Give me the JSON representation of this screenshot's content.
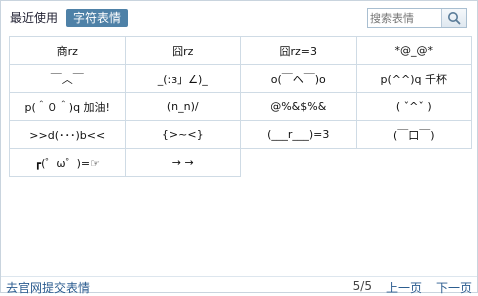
{
  "tabs": [
    {
      "label": "最近使用",
      "active": false
    },
    {
      "label": "字符表情",
      "active": true
    }
  ],
  "search": {
    "placeholder": "搜索表情",
    "icon": "search-icon"
  },
  "emoticons": [
    "商rz",
    "囧rz",
    "囧rz=3",
    "*@_@*",
    "￣︿￣",
    "_(:з」∠)_",
    "o(￣ヘ￣)o",
    "p(^^)q 千杯",
    "p(＾０＾)q 加油!",
    "(n_n)/",
    "@%&$%&",
    "( ˇ^ˇ )",
    ">>d(･･･)b<<",
    "{>~<}",
    "(___r___)=3",
    "(￣口￣)",
    "┏(゜ω゜)=☞",
    "→ →"
  ],
  "footer": {
    "submit_link": "去官网提交表情",
    "page_info": "5/5",
    "prev": "上一页",
    "next": "下一页"
  },
  "colors": {
    "accent": "#4e81a7",
    "link": "#2a5b8f",
    "grid_line": "#cfdbe5"
  }
}
